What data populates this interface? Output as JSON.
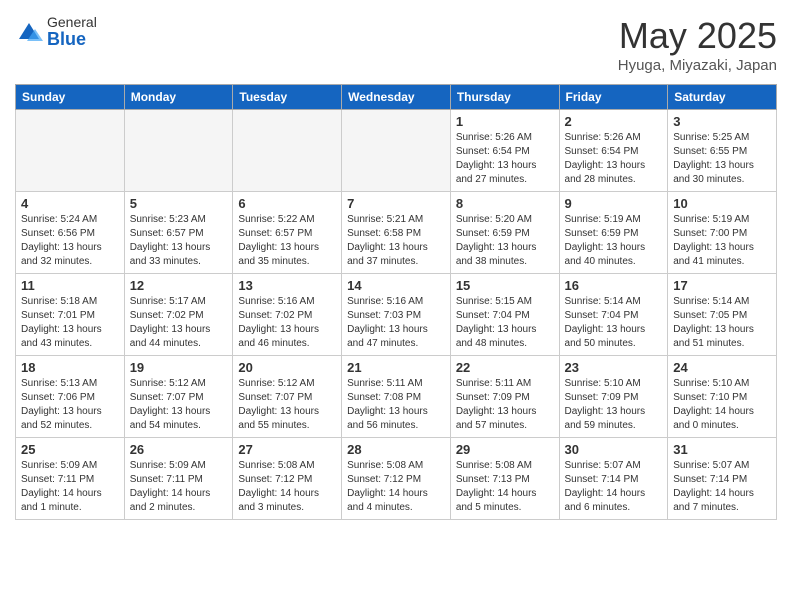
{
  "logo": {
    "general": "General",
    "blue": "Blue"
  },
  "title": "May 2025",
  "location": "Hyuga, Miyazaki, Japan",
  "days_of_week": [
    "Sunday",
    "Monday",
    "Tuesday",
    "Wednesday",
    "Thursday",
    "Friday",
    "Saturday"
  ],
  "weeks": [
    [
      {
        "day": "",
        "info": "",
        "empty": true
      },
      {
        "day": "",
        "info": "",
        "empty": true
      },
      {
        "day": "",
        "info": "",
        "empty": true
      },
      {
        "day": "",
        "info": "",
        "empty": true
      },
      {
        "day": "1",
        "info": "Sunrise: 5:26 AM\nSunset: 6:54 PM\nDaylight: 13 hours\nand 27 minutes."
      },
      {
        "day": "2",
        "info": "Sunrise: 5:26 AM\nSunset: 6:54 PM\nDaylight: 13 hours\nand 28 minutes."
      },
      {
        "day": "3",
        "info": "Sunrise: 5:25 AM\nSunset: 6:55 PM\nDaylight: 13 hours\nand 30 minutes."
      }
    ],
    [
      {
        "day": "4",
        "info": "Sunrise: 5:24 AM\nSunset: 6:56 PM\nDaylight: 13 hours\nand 32 minutes."
      },
      {
        "day": "5",
        "info": "Sunrise: 5:23 AM\nSunset: 6:57 PM\nDaylight: 13 hours\nand 33 minutes."
      },
      {
        "day": "6",
        "info": "Sunrise: 5:22 AM\nSunset: 6:57 PM\nDaylight: 13 hours\nand 35 minutes."
      },
      {
        "day": "7",
        "info": "Sunrise: 5:21 AM\nSunset: 6:58 PM\nDaylight: 13 hours\nand 37 minutes."
      },
      {
        "day": "8",
        "info": "Sunrise: 5:20 AM\nSunset: 6:59 PM\nDaylight: 13 hours\nand 38 minutes."
      },
      {
        "day": "9",
        "info": "Sunrise: 5:19 AM\nSunset: 6:59 PM\nDaylight: 13 hours\nand 40 minutes."
      },
      {
        "day": "10",
        "info": "Sunrise: 5:19 AM\nSunset: 7:00 PM\nDaylight: 13 hours\nand 41 minutes."
      }
    ],
    [
      {
        "day": "11",
        "info": "Sunrise: 5:18 AM\nSunset: 7:01 PM\nDaylight: 13 hours\nand 43 minutes."
      },
      {
        "day": "12",
        "info": "Sunrise: 5:17 AM\nSunset: 7:02 PM\nDaylight: 13 hours\nand 44 minutes."
      },
      {
        "day": "13",
        "info": "Sunrise: 5:16 AM\nSunset: 7:02 PM\nDaylight: 13 hours\nand 46 minutes."
      },
      {
        "day": "14",
        "info": "Sunrise: 5:16 AM\nSunset: 7:03 PM\nDaylight: 13 hours\nand 47 minutes."
      },
      {
        "day": "15",
        "info": "Sunrise: 5:15 AM\nSunset: 7:04 PM\nDaylight: 13 hours\nand 48 minutes."
      },
      {
        "day": "16",
        "info": "Sunrise: 5:14 AM\nSunset: 7:04 PM\nDaylight: 13 hours\nand 50 minutes."
      },
      {
        "day": "17",
        "info": "Sunrise: 5:14 AM\nSunset: 7:05 PM\nDaylight: 13 hours\nand 51 minutes."
      }
    ],
    [
      {
        "day": "18",
        "info": "Sunrise: 5:13 AM\nSunset: 7:06 PM\nDaylight: 13 hours\nand 52 minutes."
      },
      {
        "day": "19",
        "info": "Sunrise: 5:12 AM\nSunset: 7:07 PM\nDaylight: 13 hours\nand 54 minutes."
      },
      {
        "day": "20",
        "info": "Sunrise: 5:12 AM\nSunset: 7:07 PM\nDaylight: 13 hours\nand 55 minutes."
      },
      {
        "day": "21",
        "info": "Sunrise: 5:11 AM\nSunset: 7:08 PM\nDaylight: 13 hours\nand 56 minutes."
      },
      {
        "day": "22",
        "info": "Sunrise: 5:11 AM\nSunset: 7:09 PM\nDaylight: 13 hours\nand 57 minutes."
      },
      {
        "day": "23",
        "info": "Sunrise: 5:10 AM\nSunset: 7:09 PM\nDaylight: 13 hours\nand 59 minutes."
      },
      {
        "day": "24",
        "info": "Sunrise: 5:10 AM\nSunset: 7:10 PM\nDaylight: 14 hours\nand 0 minutes."
      }
    ],
    [
      {
        "day": "25",
        "info": "Sunrise: 5:09 AM\nSunset: 7:11 PM\nDaylight: 14 hours\nand 1 minute."
      },
      {
        "day": "26",
        "info": "Sunrise: 5:09 AM\nSunset: 7:11 PM\nDaylight: 14 hours\nand 2 minutes."
      },
      {
        "day": "27",
        "info": "Sunrise: 5:08 AM\nSunset: 7:12 PM\nDaylight: 14 hours\nand 3 minutes."
      },
      {
        "day": "28",
        "info": "Sunrise: 5:08 AM\nSunset: 7:12 PM\nDaylight: 14 hours\nand 4 minutes."
      },
      {
        "day": "29",
        "info": "Sunrise: 5:08 AM\nSunset: 7:13 PM\nDaylight: 14 hours\nand 5 minutes."
      },
      {
        "day": "30",
        "info": "Sunrise: 5:07 AM\nSunset: 7:14 PM\nDaylight: 14 hours\nand 6 minutes."
      },
      {
        "day": "31",
        "info": "Sunrise: 5:07 AM\nSunset: 7:14 PM\nDaylight: 14 hours\nand 7 minutes."
      }
    ]
  ]
}
